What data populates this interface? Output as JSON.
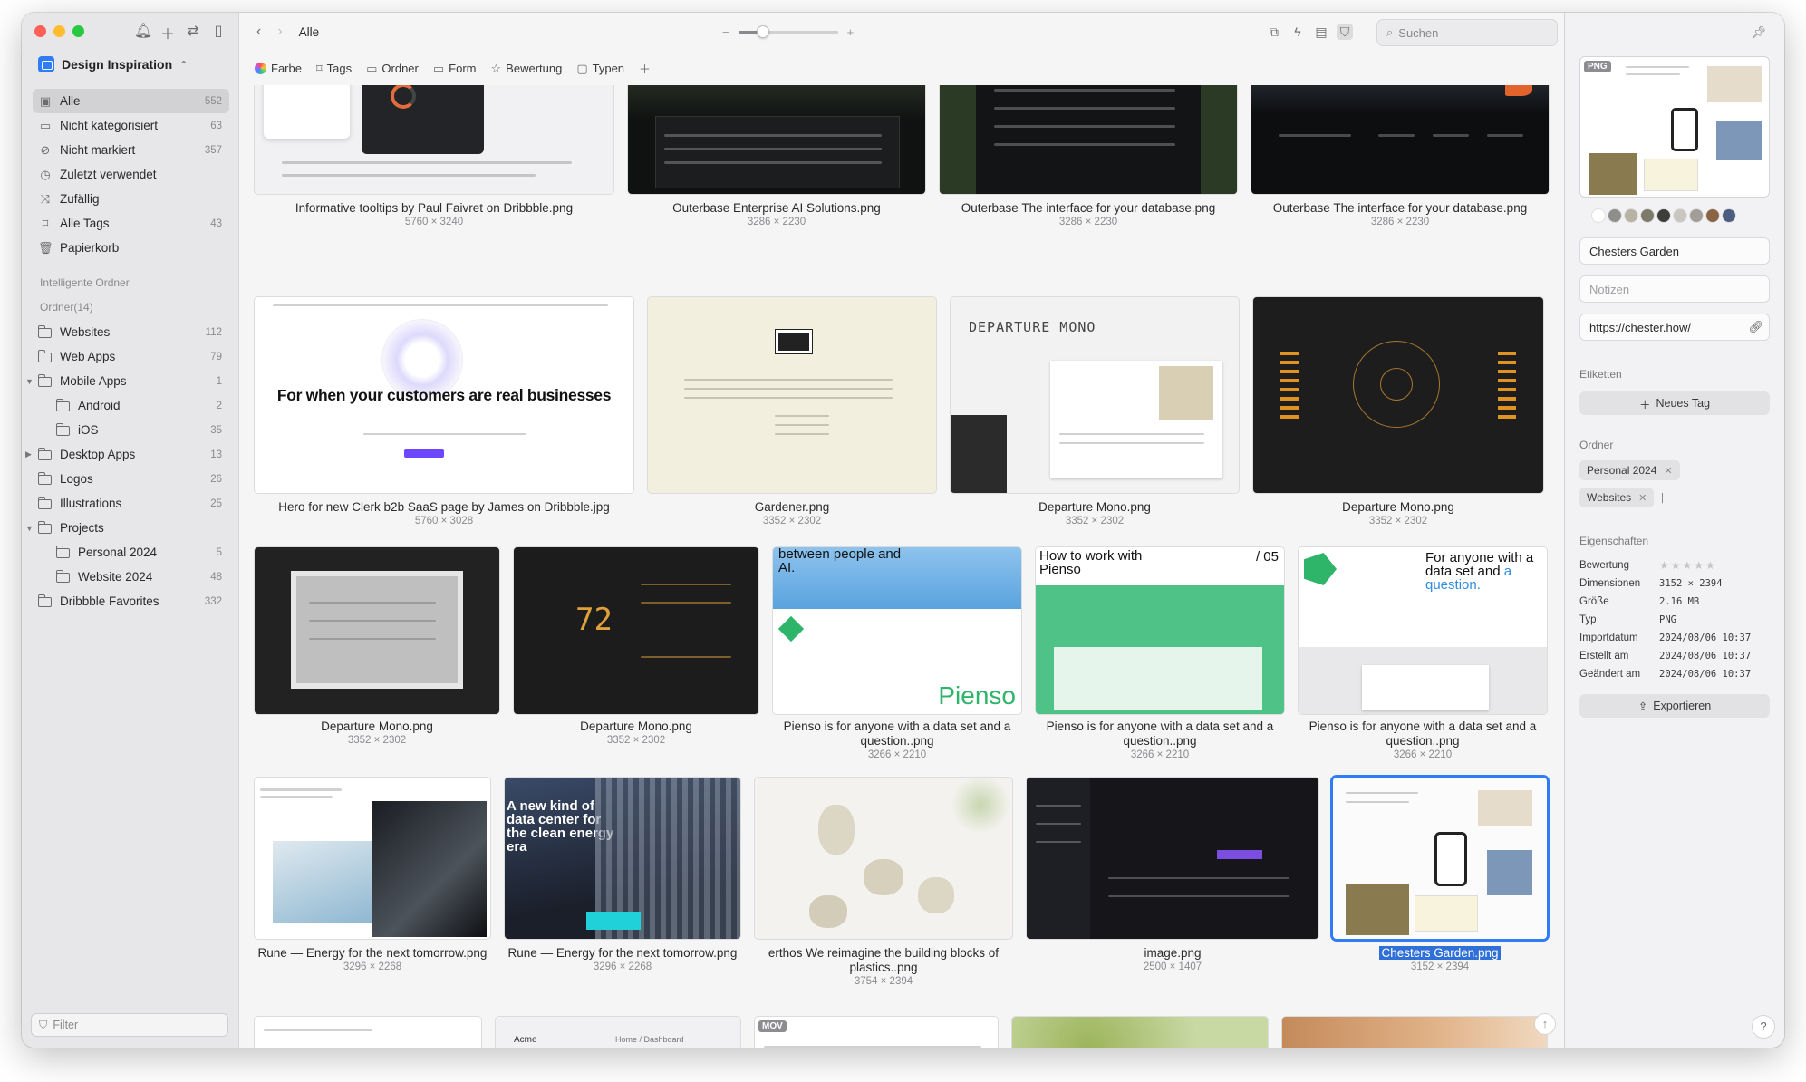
{
  "library": {
    "name": "Design Inspiration"
  },
  "sidebar": {
    "items": [
      {
        "label": "Alle",
        "count": "552"
      },
      {
        "label": "Nicht kategorisiert",
        "count": "63"
      },
      {
        "label": "Nicht markiert",
        "count": "357"
      },
      {
        "label": "Zuletzt verwendet",
        "count": ""
      },
      {
        "label": "Zufällig",
        "count": ""
      },
      {
        "label": "Alle Tags",
        "count": "43"
      },
      {
        "label": "Papierkorb",
        "count": ""
      }
    ],
    "smart_folders_heading": "Intelligente Ordner",
    "folders_heading": "Ordner(14)",
    "folders": [
      {
        "label": "Websites",
        "count": "112"
      },
      {
        "label": "Web Apps",
        "count": "79"
      },
      {
        "label": "Mobile Apps",
        "count": "1"
      },
      {
        "label": "Android",
        "count": "2"
      },
      {
        "label": "iOS",
        "count": "35"
      },
      {
        "label": "Desktop Apps",
        "count": "13"
      },
      {
        "label": "Logos",
        "count": "26"
      },
      {
        "label": "Illustrations",
        "count": "25"
      },
      {
        "label": "Projects",
        "count": ""
      },
      {
        "label": "Personal 2024",
        "count": "5"
      },
      {
        "label": "Website 2024",
        "count": "48"
      },
      {
        "label": "Dribbble Favorites",
        "count": "332"
      }
    ],
    "filter_placeholder": "Filter"
  },
  "toolbar": {
    "breadcrumb": "Alle",
    "search_placeholder": "Suchen",
    "zoom_level": 0.25
  },
  "filters": [
    "Farbe",
    "Tags",
    "Ordner",
    "Form",
    "Bewertung",
    "Typen"
  ],
  "grid": {
    "row1": [
      {
        "name": "Informative tooltips by Paul Faivret on Dribbble.png",
        "dims": "5760 × 3240"
      },
      {
        "name": "Outerbase Enterprise AI Solutions.png",
        "dims": "3286 × 2230"
      },
      {
        "name": "Outerbase The interface for your database.png",
        "dims": "3286 × 2230"
      },
      {
        "name": "Outerbase The interface for your database.png",
        "dims": "3286 × 2230"
      }
    ],
    "row2": [
      {
        "name": "Hero for new Clerk b2b SaaS page by James on Dribbble.jpg",
        "dims": "5760 × 3028",
        "hero_text": "For when your customers are real businesses"
      },
      {
        "name": "Gardener.png",
        "dims": "3352 × 2302"
      },
      {
        "name": "Departure Mono.png",
        "dims": "3352 × 2302",
        "thumb_title": "DEPARTURE MONO"
      },
      {
        "name": "Departure Mono.png",
        "dims": "3352 × 2302"
      }
    ],
    "row3": [
      {
        "name": "Departure Mono.png",
        "dims": "3352 × 2302"
      },
      {
        "name": "Departure Mono.png",
        "dims": "3352 × 2302",
        "thumb_number": "72"
      },
      {
        "name": "Pienso is for anyone with a data set and a question..png",
        "dims": "3266 × 2210",
        "thumb_head": "between people and AI.",
        "thumb_brand": "Pienso"
      },
      {
        "name": "Pienso is for anyone with a data set and a question..png",
        "dims": "3266 × 2210",
        "thumb_head": "How to work with Pienso",
        "thumb_num": "/ 05"
      },
      {
        "name": "Pienso is for anyone with a data set and a question..png",
        "dims": "3266 × 2210",
        "thumb_head": "For anyone with a data set and",
        "thumb_accent": "a question."
      }
    ],
    "row4": [
      {
        "name": "Rune — Energy for the next tomorrow.png",
        "dims": "3296 × 2268"
      },
      {
        "name": "Rune — Energy for the next tomorrow.png",
        "dims": "3296 × 2268",
        "thumb_head": "A new kind of data center for the clean energy era"
      },
      {
        "name": "erthos We reimagine the building blocks of plastics..png",
        "dims": "3754 × 2394"
      },
      {
        "name": "image.png",
        "dims": "2500 × 1407"
      },
      {
        "name": "Chesters Garden.png",
        "dims": "3152 × 2394"
      }
    ],
    "row5_labels": [
      "Acme",
      "Home / Dashboard",
      "MOV"
    ]
  },
  "inspector": {
    "badge": "PNG",
    "title": "Chesters Garden",
    "notes_placeholder": "Notizen",
    "url": "https://chester.how/",
    "tags_heading": "Etiketten",
    "new_tag": "Neues Tag",
    "folders_heading": "Ordner",
    "folder_tags": [
      "Personal 2024",
      "Websites"
    ],
    "props_heading": "Eigenschaften",
    "props": [
      {
        "k": "Bewertung",
        "v": "★★★★★"
      },
      {
        "k": "Dimensionen",
        "v": "3152 × 2394"
      },
      {
        "k": "Größe",
        "v": "2.16 MB"
      },
      {
        "k": "Typ",
        "v": "PNG"
      },
      {
        "k": "Importdatum",
        "v": "2024/08/06 10:37"
      },
      {
        "k": "Erstellt am",
        "v": "2024/08/06 10:37"
      },
      {
        "k": "Geändert am",
        "v": "2024/08/06 10:37"
      }
    ],
    "export": "Exportieren",
    "palette": [
      "#ffffff",
      "#8e8e8a",
      "#b7b2a2",
      "#7d7a6a",
      "#3d3d3a",
      "#c9c6c0",
      "#a39d97",
      "#8a6344",
      "#4b5e80"
    ]
  }
}
